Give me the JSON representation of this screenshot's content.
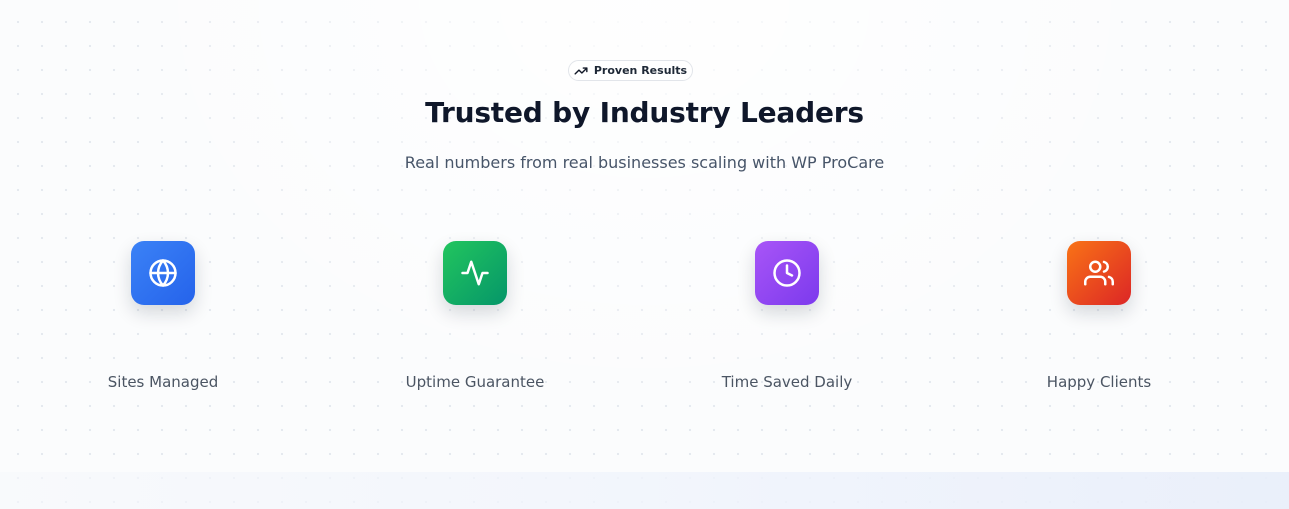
{
  "badge": {
    "icon": "trending-up-icon",
    "label": "Proven Results"
  },
  "header": {
    "title": "Trusted by Industry Leaders",
    "subtitle": "Real numbers from real businesses scaling with WP ProCare"
  },
  "stats": [
    {
      "label": "Sites Managed",
      "icon": "globe-icon",
      "color_from": "#3b82f6",
      "color_to": "#2563eb"
    },
    {
      "label": "Uptime Guarantee",
      "icon": "activity-icon",
      "color_from": "#22c55e",
      "color_to": "#059669"
    },
    {
      "label": "Time Saved Daily",
      "icon": "clock-icon",
      "color_from": "#a855f7",
      "color_to": "#7c3aed"
    },
    {
      "label": "Happy Clients",
      "icon": "users-icon",
      "color_from": "#f97316",
      "color_to": "#dc2626"
    }
  ]
}
